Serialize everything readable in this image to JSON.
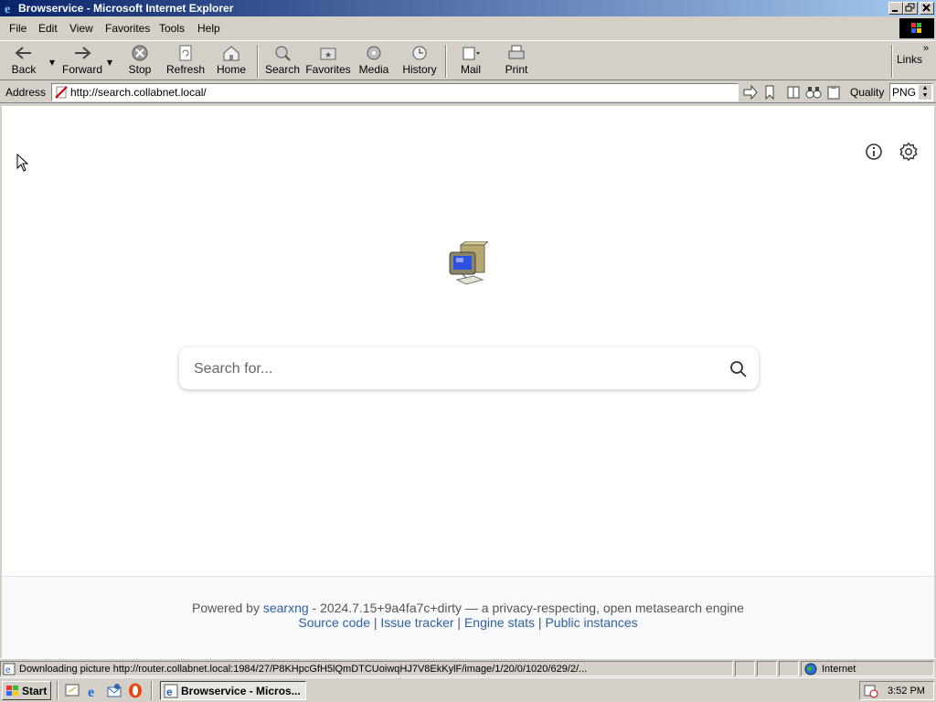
{
  "window": {
    "title": "Browservice - Microsoft Internet Explorer"
  },
  "menu": {
    "items": [
      "File",
      "Edit",
      "View",
      "Favorites",
      "Tools",
      "Help"
    ]
  },
  "toolbar": {
    "back": "Back",
    "forward": "Forward",
    "stop": "Stop",
    "refresh": "Refresh",
    "home": "Home",
    "search": "Search",
    "favorites": "Favorites",
    "media": "Media",
    "history": "History",
    "mail": "Mail",
    "print": "Print",
    "links": "Links"
  },
  "address": {
    "label": "Address",
    "url": "http://search.collabnet.local/",
    "quality_label": "Quality",
    "quality_value": "PNG"
  },
  "page": {
    "search_placeholder": "Search for...",
    "footer": {
      "powered_by": "Powered by",
      "engine": "searxng",
      "version_text": " - 2024.7.15+9a4fa7c+dirty — a privacy-respecting, open metasearch engine",
      "links": [
        "Source code",
        "Issue tracker",
        "Engine stats",
        "Public instances"
      ],
      "separator": " | "
    }
  },
  "status": {
    "text": "Downloading picture http://router.collabnet.local:1984/27/P8KHpcGfH5lQmDTCUoiwqHJ7V8EkKylF/image/1/20/0/1020/629/2/...",
    "zone": "Internet"
  },
  "taskbar": {
    "start": "Start",
    "task": "Browservice - Micros...",
    "clock": "3:52 PM"
  }
}
